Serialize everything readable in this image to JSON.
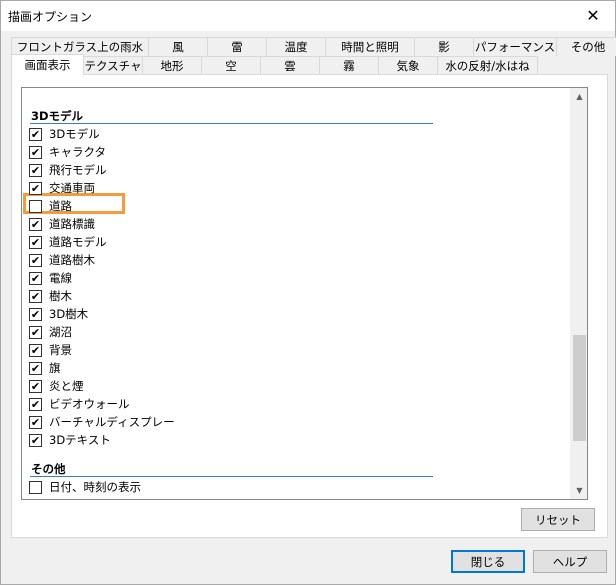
{
  "window": {
    "title": "描画オプション",
    "close_glyph": "✕"
  },
  "tabs_row1": [
    "フロントガラス上の雨水",
    "風",
    "雷",
    "温度",
    "時間と照明",
    "影",
    "パフォーマンス",
    "その他"
  ],
  "tabs_row2": [
    "画面表示",
    "テクスチャ",
    "地形",
    "空",
    "雲",
    "霧",
    "気象",
    "水の反射/水はね"
  ],
  "active_tab": "画面表示",
  "sections": [
    {
      "title": "3Dモデル",
      "items": [
        {
          "label": "3Dモデル",
          "checked": true
        },
        {
          "label": "キャラクタ",
          "checked": true
        },
        {
          "label": "飛行モデル",
          "checked": true
        },
        {
          "label": "交通車両",
          "checked": true
        },
        {
          "label": "道路",
          "checked": false
        },
        {
          "label": "道路標識",
          "checked": true
        },
        {
          "label": "道路モデル",
          "checked": true
        },
        {
          "label": "道路樹木",
          "checked": true
        },
        {
          "label": "電線",
          "checked": true
        },
        {
          "label": "樹木",
          "checked": true
        },
        {
          "label": "3D樹木",
          "checked": true
        },
        {
          "label": "湖沼",
          "checked": true
        },
        {
          "label": "背景",
          "checked": true
        },
        {
          "label": "旗",
          "checked": true
        },
        {
          "label": "炎と煙",
          "checked": true
        },
        {
          "label": "ビデオウォール",
          "checked": true
        },
        {
          "label": "バーチャルディスプレー",
          "checked": true
        },
        {
          "label": "3Dテキスト",
          "checked": true
        }
      ]
    },
    {
      "title": "その他",
      "items": [
        {
          "label": "日付、時刻の表示",
          "checked": false
        }
      ]
    }
  ],
  "buttons": {
    "reset": "リセット",
    "close": "閉じる",
    "help": "ヘルプ"
  },
  "colors": {
    "highlight": "#f39c3e",
    "primary_border": "#0078d7"
  }
}
